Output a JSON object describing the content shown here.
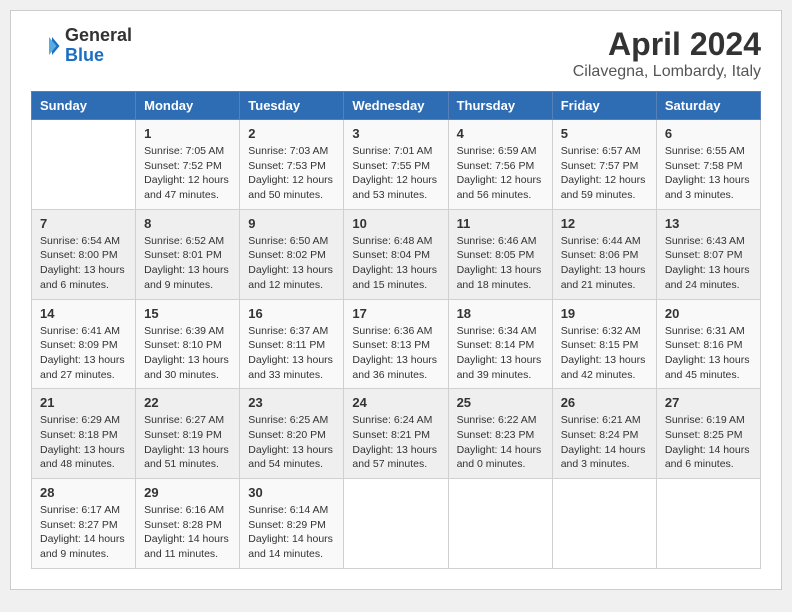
{
  "header": {
    "logo_general": "General",
    "logo_blue": "Blue",
    "title": "April 2024",
    "subtitle": "Cilavegna, Lombardy, Italy"
  },
  "days_of_week": [
    "Sunday",
    "Monday",
    "Tuesday",
    "Wednesday",
    "Thursday",
    "Friday",
    "Saturday"
  ],
  "weeks": [
    [
      {
        "day": "",
        "content": ""
      },
      {
        "day": "1",
        "content": "Sunrise: 7:05 AM\nSunset: 7:52 PM\nDaylight: 12 hours\nand 47 minutes."
      },
      {
        "day": "2",
        "content": "Sunrise: 7:03 AM\nSunset: 7:53 PM\nDaylight: 12 hours\nand 50 minutes."
      },
      {
        "day": "3",
        "content": "Sunrise: 7:01 AM\nSunset: 7:55 PM\nDaylight: 12 hours\nand 53 minutes."
      },
      {
        "day": "4",
        "content": "Sunrise: 6:59 AM\nSunset: 7:56 PM\nDaylight: 12 hours\nand 56 minutes."
      },
      {
        "day": "5",
        "content": "Sunrise: 6:57 AM\nSunset: 7:57 PM\nDaylight: 12 hours\nand 59 minutes."
      },
      {
        "day": "6",
        "content": "Sunrise: 6:55 AM\nSunset: 7:58 PM\nDaylight: 13 hours\nand 3 minutes."
      }
    ],
    [
      {
        "day": "7",
        "content": "Sunrise: 6:54 AM\nSunset: 8:00 PM\nDaylight: 13 hours\nand 6 minutes."
      },
      {
        "day": "8",
        "content": "Sunrise: 6:52 AM\nSunset: 8:01 PM\nDaylight: 13 hours\nand 9 minutes."
      },
      {
        "day": "9",
        "content": "Sunrise: 6:50 AM\nSunset: 8:02 PM\nDaylight: 13 hours\nand 12 minutes."
      },
      {
        "day": "10",
        "content": "Sunrise: 6:48 AM\nSunset: 8:04 PM\nDaylight: 13 hours\nand 15 minutes."
      },
      {
        "day": "11",
        "content": "Sunrise: 6:46 AM\nSunset: 8:05 PM\nDaylight: 13 hours\nand 18 minutes."
      },
      {
        "day": "12",
        "content": "Sunrise: 6:44 AM\nSunset: 8:06 PM\nDaylight: 13 hours\nand 21 minutes."
      },
      {
        "day": "13",
        "content": "Sunrise: 6:43 AM\nSunset: 8:07 PM\nDaylight: 13 hours\nand 24 minutes."
      }
    ],
    [
      {
        "day": "14",
        "content": "Sunrise: 6:41 AM\nSunset: 8:09 PM\nDaylight: 13 hours\nand 27 minutes."
      },
      {
        "day": "15",
        "content": "Sunrise: 6:39 AM\nSunset: 8:10 PM\nDaylight: 13 hours\nand 30 minutes."
      },
      {
        "day": "16",
        "content": "Sunrise: 6:37 AM\nSunset: 8:11 PM\nDaylight: 13 hours\nand 33 minutes."
      },
      {
        "day": "17",
        "content": "Sunrise: 6:36 AM\nSunset: 8:13 PM\nDaylight: 13 hours\nand 36 minutes."
      },
      {
        "day": "18",
        "content": "Sunrise: 6:34 AM\nSunset: 8:14 PM\nDaylight: 13 hours\nand 39 minutes."
      },
      {
        "day": "19",
        "content": "Sunrise: 6:32 AM\nSunset: 8:15 PM\nDaylight: 13 hours\nand 42 minutes."
      },
      {
        "day": "20",
        "content": "Sunrise: 6:31 AM\nSunset: 8:16 PM\nDaylight: 13 hours\nand 45 minutes."
      }
    ],
    [
      {
        "day": "21",
        "content": "Sunrise: 6:29 AM\nSunset: 8:18 PM\nDaylight: 13 hours\nand 48 minutes."
      },
      {
        "day": "22",
        "content": "Sunrise: 6:27 AM\nSunset: 8:19 PM\nDaylight: 13 hours\nand 51 minutes."
      },
      {
        "day": "23",
        "content": "Sunrise: 6:25 AM\nSunset: 8:20 PM\nDaylight: 13 hours\nand 54 minutes."
      },
      {
        "day": "24",
        "content": "Sunrise: 6:24 AM\nSunset: 8:21 PM\nDaylight: 13 hours\nand 57 minutes."
      },
      {
        "day": "25",
        "content": "Sunrise: 6:22 AM\nSunset: 8:23 PM\nDaylight: 14 hours\nand 0 minutes."
      },
      {
        "day": "26",
        "content": "Sunrise: 6:21 AM\nSunset: 8:24 PM\nDaylight: 14 hours\nand 3 minutes."
      },
      {
        "day": "27",
        "content": "Sunrise: 6:19 AM\nSunset: 8:25 PM\nDaylight: 14 hours\nand 6 minutes."
      }
    ],
    [
      {
        "day": "28",
        "content": "Sunrise: 6:17 AM\nSunset: 8:27 PM\nDaylight: 14 hours\nand 9 minutes."
      },
      {
        "day": "29",
        "content": "Sunrise: 6:16 AM\nSunset: 8:28 PM\nDaylight: 14 hours\nand 11 minutes."
      },
      {
        "day": "30",
        "content": "Sunrise: 6:14 AM\nSunset: 8:29 PM\nDaylight: 14 hours\nand 14 minutes."
      },
      {
        "day": "",
        "content": ""
      },
      {
        "day": "",
        "content": ""
      },
      {
        "day": "",
        "content": ""
      },
      {
        "day": "",
        "content": ""
      }
    ]
  ]
}
